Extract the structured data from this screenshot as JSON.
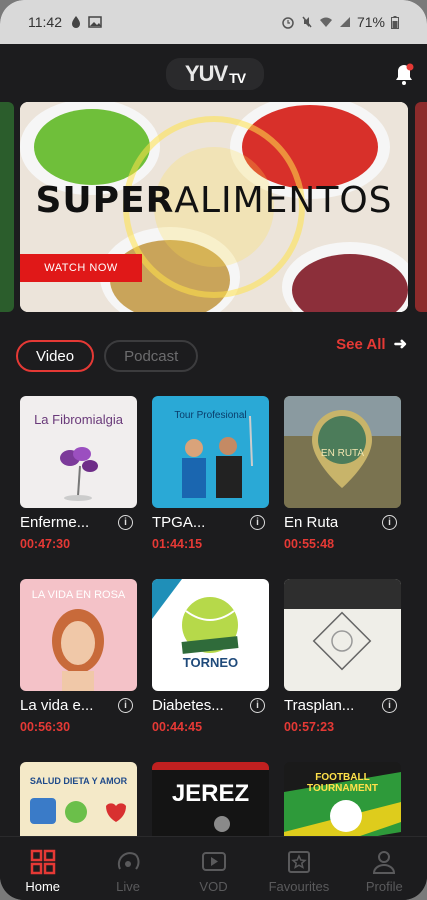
{
  "status_bar": {
    "time": "11:42",
    "battery": "71%"
  },
  "header": {
    "logo_text": "YUV",
    "logo_suffix": "TV"
  },
  "banner": {
    "title_bold": "SUPER",
    "title_light": "ALIMENTOS",
    "watch_label": "WATCH NOW"
  },
  "tabs": [
    {
      "label": "Video",
      "active": true
    },
    {
      "label": "Podcast",
      "active": false
    }
  ],
  "see_all": "See All",
  "cards": [
    {
      "title": "Enferme...",
      "duration": "00:47:30",
      "thumb_text": "La Fibromialgia"
    },
    {
      "title": "TPGA...",
      "duration": "01:44:15",
      "thumb_text": "Tour Profesional"
    },
    {
      "title": "En Ruta",
      "duration": "00:55:48",
      "thumb_text": "EN RUTA"
    },
    {
      "title": "La vida e...",
      "duration": "00:56:30",
      "thumb_text": "LA VIDA EN ROSA"
    },
    {
      "title": "Diabetes...",
      "duration": "00:44:45",
      "thumb_text": "TORNEO"
    },
    {
      "title": "Trasplan...",
      "duration": "00:57:23",
      "thumb_text": ""
    },
    {
      "title": "",
      "duration": "",
      "thumb_text": "SALUD DIETA Y AMOR"
    },
    {
      "title": "",
      "duration": "",
      "thumb_text": "JEREZ"
    },
    {
      "title": "",
      "duration": "",
      "thumb_text": "FOOTBALL TOURNAMENT"
    }
  ],
  "nav": [
    {
      "label": "Home",
      "icon": "home-grid-icon",
      "active": true
    },
    {
      "label": "Live",
      "icon": "live-icon",
      "active": false
    },
    {
      "label": "VOD",
      "icon": "play-icon",
      "active": false
    },
    {
      "label": "Favourites",
      "icon": "star-icon",
      "active": false
    },
    {
      "label": "Profile",
      "icon": "user-icon",
      "active": false
    }
  ],
  "colors": {
    "accent": "#e53935",
    "background": "#1c1c1e"
  }
}
